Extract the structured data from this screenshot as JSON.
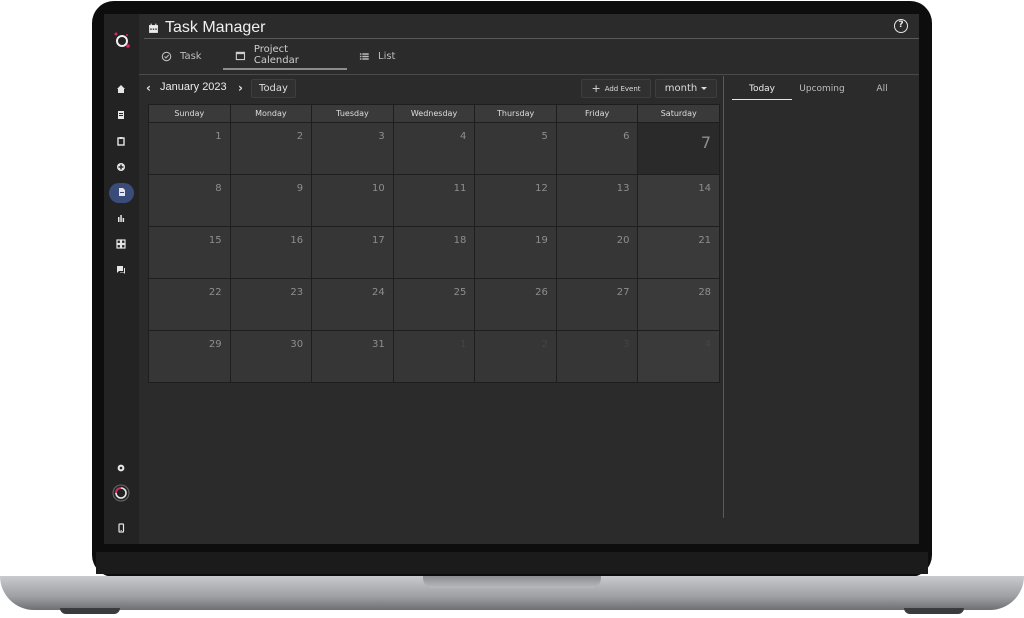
{
  "app": {
    "title": "Task Manager",
    "help_label": "?"
  },
  "nav_tabs": [
    {
      "label": "Task",
      "icon": "task-check-icon"
    },
    {
      "label": "Project Calendar",
      "icon": "calendar-icon",
      "active": true
    },
    {
      "label": "List",
      "icon": "list-icon"
    }
  ],
  "sidebar": {
    "items": [
      {
        "icon": "home-icon"
      },
      {
        "icon": "document-icon"
      },
      {
        "icon": "clipboard-icon"
      },
      {
        "icon": "plus-circle-icon"
      },
      {
        "icon": "file-icon",
        "active": true
      },
      {
        "icon": "bar-chart-icon"
      },
      {
        "icon": "grid-icon"
      },
      {
        "icon": "chat-icon"
      }
    ],
    "bottom": [
      {
        "icon": "settings-icon"
      },
      {
        "icon": "avatar-ring-icon"
      },
      {
        "icon": "mobile-icon"
      }
    ]
  },
  "calendar": {
    "month_label": "January 2023",
    "prev_label": "‹",
    "next_label": "›",
    "today_button": "Today",
    "add_event_button": "Add Event",
    "view_select": "month",
    "weekdays": [
      "Sunday",
      "Monday",
      "Tuesday",
      "Wednesday",
      "Thursday",
      "Friday",
      "Saturday"
    ],
    "weeks": [
      [
        "1",
        "2",
        "3",
        "4",
        "5",
        "6",
        "7"
      ],
      [
        "8",
        "9",
        "10",
        "11",
        "12",
        "13",
        "14"
      ],
      [
        "15",
        "16",
        "17",
        "18",
        "19",
        "20",
        "21"
      ],
      [
        "22",
        "23",
        "24",
        "25",
        "26",
        "27",
        "28"
      ],
      [
        "29",
        "30",
        "31",
        "1",
        "2",
        "3",
        "4"
      ]
    ],
    "today_day": "7",
    "muted_cells": [
      [
        4,
        3
      ],
      [
        4,
        4
      ],
      [
        4,
        5
      ],
      [
        4,
        6
      ]
    ]
  },
  "events_panel": {
    "tabs": [
      "Today",
      "Upcoming",
      "All"
    ],
    "active_tab": "Today"
  },
  "colors": {
    "background": "#2b2b2b",
    "sidebar": "#232323",
    "active_sidebar": "#3a4d7a",
    "logo_accent": "#e0245e"
  }
}
